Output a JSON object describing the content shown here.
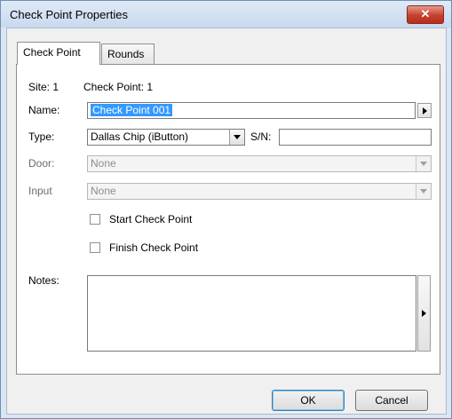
{
  "window": {
    "title": "Check Point Properties",
    "close_label": "✕"
  },
  "tabs": [
    {
      "label": "Check Point"
    },
    {
      "label": "Rounds"
    }
  ],
  "form": {
    "site_label": "Site: 1",
    "checkpoint_label": "Check Point: 1",
    "name_label": "Name:",
    "name_value": "Check Point 001",
    "type_label": "Type:",
    "type_value": "Dallas Chip (iButton)",
    "sn_label": "S/N:",
    "sn_value": "",
    "door_label": "Door:",
    "door_value": "None",
    "input_label": "Input",
    "input_value": "None",
    "start_label": "Start Check Point",
    "finish_label": "Finish Check Point",
    "notes_label": "Notes:",
    "notes_value": ""
  },
  "buttons": {
    "ok_label": "OK",
    "cancel_label": "Cancel"
  },
  "icons": {
    "close": "close-icon",
    "name_arrow": "chevron-right-icon",
    "dropdown": "chevron-down-icon",
    "notes_arrow": "chevron-right-icon"
  }
}
